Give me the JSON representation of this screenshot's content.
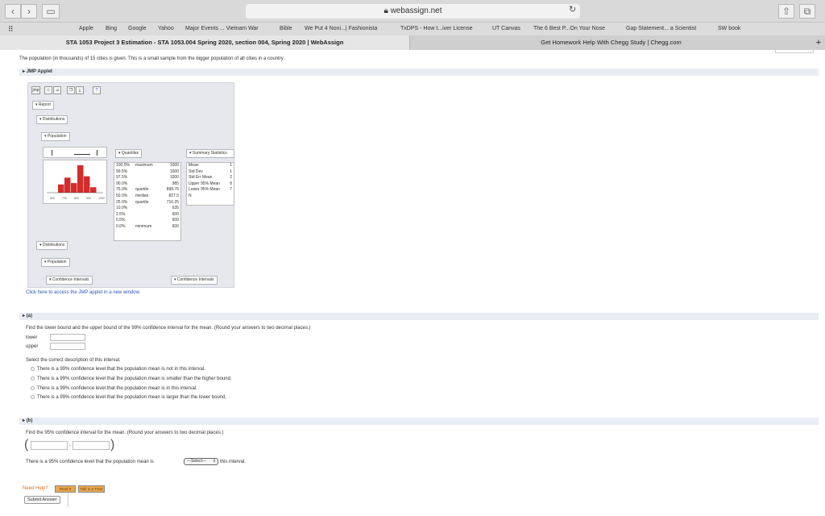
{
  "browser": {
    "url": "webassign.net",
    "favorites": [
      "Apple",
      "Bing",
      "Google",
      "Yahoo",
      "Major Events ... Vietnam War",
      "Bible",
      "We Put 4 Noni...| Fashionista",
      "TxDPS - How t...iver License",
      "UT Canvas",
      "The 6 Best P...On Your Nose",
      "Gap Statement... a Scientist",
      "SW book"
    ],
    "tabs": [
      {
        "label": "STA 1053 Project 3 Estimation - STA 1053.004 Spring 2020, section 004, Spring 2020 | WebAssign"
      },
      {
        "label": "Get Homework Help With Chegg Study | Chegg.com"
      }
    ]
  },
  "page": {
    "intro": "The population (in thousands) of 15 cities is given. This is a small sample from the bigger population of all cities in a country.",
    "jmp_header": "JMP Applet",
    "applet": {
      "report": "Report",
      "distributions": "Distributions",
      "population": "Population",
      "quantiles_title": "Quantiles",
      "summary_title": "Summary Statistics",
      "quantiles": [
        [
          "100.0%",
          "maximum",
          "1000"
        ],
        [
          "99.5%",
          "",
          "1000"
        ],
        [
          "97.5%",
          "",
          "1000"
        ],
        [
          "90.0%",
          "",
          "985"
        ],
        [
          "75.0%",
          "quartile",
          "898.75"
        ],
        [
          "50.0%",
          "median",
          "827.5"
        ],
        [
          "25.0%",
          "quartile",
          "716.25"
        ],
        [
          "10.0%",
          "",
          "635"
        ],
        [
          "2.5%",
          "",
          "600"
        ],
        [
          "0.5%",
          "",
          "600"
        ],
        [
          "0.0%",
          "minimum",
          "600"
        ]
      ],
      "summary": [
        [
          "Mean",
          "1"
        ],
        [
          "Std Dev",
          "1"
        ],
        [
          "Std Err Mean",
          "2"
        ],
        [
          "Upper 95% Mean",
          "8"
        ],
        [
          "Lower 95% Mean",
          "7"
        ],
        [
          "N",
          ""
        ]
      ],
      "distributions2": "Distributions",
      "population2": "Population",
      "ci_left": "Confidence Intervals",
      "ci_right": "Confidence Intervals",
      "hist_ticks": [
        "600",
        "700",
        "800",
        "900",
        "1000"
      ]
    },
    "jmp_link": "Click here to access the JMP applet in a new window.",
    "part_a": {
      "label": "(a)",
      "question": "Find the lower bound and the upper bound of the 99% confidence interval for the mean. (Round your answers to two decimal places.)",
      "lower": "lower",
      "upper": "upper",
      "select_prompt": "Select the correct description of this interval.",
      "options": [
        "There is a 99% confidence level that the population mean is not in this interval.",
        "There is a 99% confidence level that the population mean is smaller than the higher bound.",
        "There is a 99% confidence level that the population mean is in this interval.",
        "There is a 99% confidence level that the population mean is larger than the lower bound."
      ]
    },
    "part_b": {
      "label": "(b)",
      "question": "Find the 95% confidence interval for the mean. (Round your answers to two decimal places.)",
      "sentence_before": "There is a 95% confidence level that the population mean is",
      "select_value": "---Select---",
      "sentence_after": "this interval."
    },
    "need_help": "Need Help?",
    "read_it": "Read It",
    "talk_tutor": "Talk to a Tutor",
    "submit": "Submit Answer"
  },
  "histogram": {
    "values": [
      0.3,
      0.55,
      0.35,
      1.0,
      0.6,
      0.2
    ]
  }
}
